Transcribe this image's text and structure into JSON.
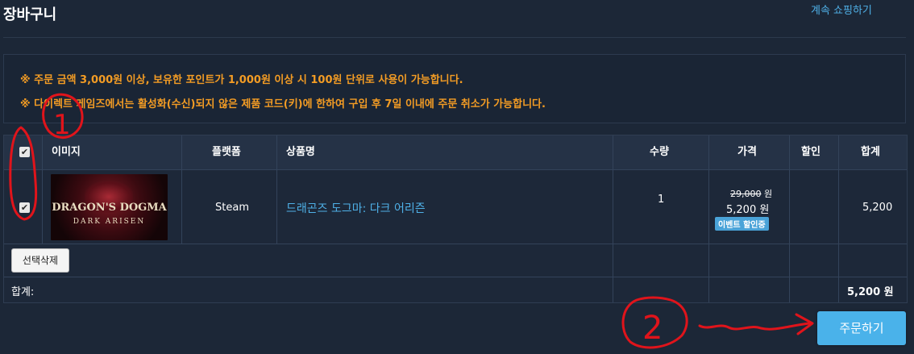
{
  "header": {
    "title": "장바구니",
    "continue_link": "계속 쇼핑하기"
  },
  "notices": [
    "※ 주문 금액 3,000원 이상, 보유한 포인트가 1,000원 이상 시 100원 단위로 사용이 가능합니다.",
    "※ 다이렉트 게임즈에서는 활성화(수신)되지 않은 제품 코드(키)에 한하여 구입 후 7일 이내에 주문 취소가 가능합니다."
  ],
  "table": {
    "columns": {
      "image": "이미지",
      "platform": "플랫폼",
      "product": "상품명",
      "quantity": "수량",
      "price": "가격",
      "discount": "할인",
      "total": "합계"
    },
    "rows": [
      {
        "checked": true,
        "thumbnail_text": {
          "line1": "DRAGON'S DOGMA",
          "line2": "DARK ARISEN"
        },
        "platform": "Steam",
        "product": "드래곤즈 도그마: 다크 어리즌",
        "quantity": "1",
        "original_price": "29,000",
        "original_unit": "원",
        "price": "5,200 원",
        "badge": "이벤트 할인중",
        "discount": "",
        "total": "5,200"
      }
    ],
    "delete_selected_label": "선택삭제",
    "footer_label": "합계:",
    "footer_total": "5,200 원"
  },
  "order_button_label": "주문하기",
  "annotations": {
    "circle1_label": "1",
    "circle2_label": "2",
    "color": "#e0141b"
  },
  "colors": {
    "background": "#1c2737",
    "accent": "#4fb1e8",
    "notice": "#f39c24",
    "order_button": "#4ab2ea"
  }
}
